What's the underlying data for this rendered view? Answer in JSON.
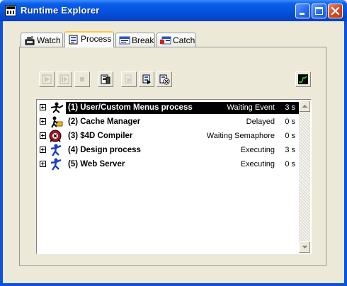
{
  "window": {
    "title": "Runtime Explorer"
  },
  "tabs": [
    {
      "label": "Watch",
      "icon": "watch-icon"
    },
    {
      "label": "Process",
      "icon": "process-icon",
      "active": true
    },
    {
      "label": "Break",
      "icon": "break-icon"
    },
    {
      "label": "Catch",
      "icon": "catch-icon"
    }
  ],
  "toolbar": [
    {
      "name": "resume-button-icon",
      "enabled": false
    },
    {
      "name": "step-button-icon",
      "enabled": false
    },
    {
      "name": "stop-button-icon",
      "enabled": false
    },
    {
      "name": "debug-button-icon",
      "enabled": true
    },
    {
      "name": "trace-button-icon",
      "enabled": false
    },
    {
      "name": "abort-button-icon",
      "enabled": true
    },
    {
      "name": "pause-button-icon",
      "enabled": true
    },
    {
      "name": "monitor-button-icon",
      "enabled": true
    }
  ],
  "processes": [
    {
      "name": "(1) User/Custom Menus process",
      "state": "Waiting Event",
      "time": "3 s",
      "selected": true,
      "icon": "user-process-icon"
    },
    {
      "name": "(2) Cache Manager",
      "state": "Delayed",
      "time": "0 s",
      "icon": "cache-manager-icon"
    },
    {
      "name": "(3) $4D Compiler",
      "state": "Waiting Semaphore",
      "time": "0 s",
      "icon": "compiler-icon"
    },
    {
      "name": "(4) Design process",
      "state": "Executing",
      "time": "3 s",
      "icon": "design-process-icon"
    },
    {
      "name": "(5) Web Server",
      "state": "Executing",
      "time": "0 s",
      "icon": "web-server-icon"
    }
  ],
  "colors": {
    "titlebar": "#0554e0",
    "selection": "#000000",
    "tab_highlight": "#ffc83c",
    "background": "#ece9d8"
  }
}
